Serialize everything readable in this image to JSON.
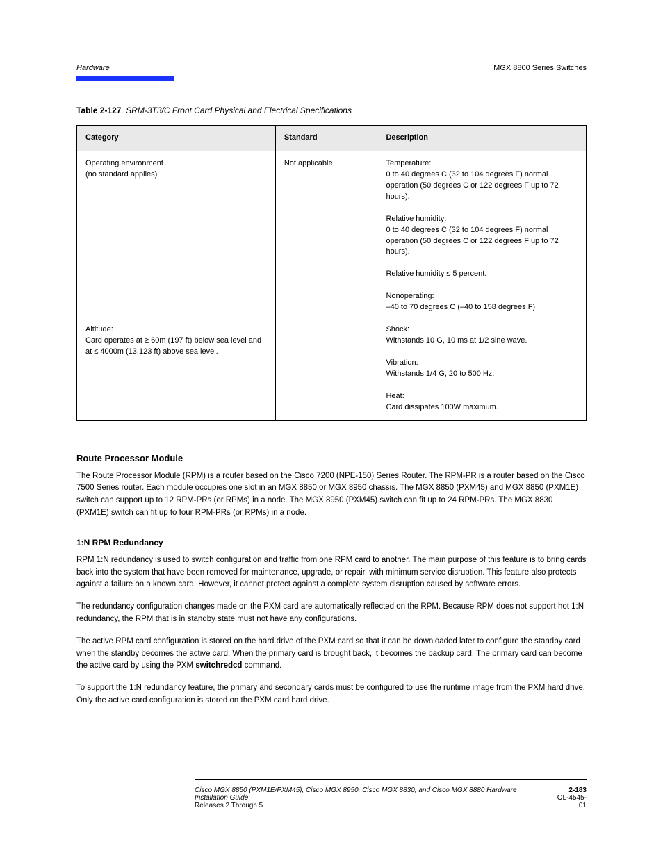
{
  "header": {
    "section": "Hardware",
    "subject": "MGX 8800 Series Switches"
  },
  "table": {
    "caption_prefix": "Table 2-127",
    "caption_text": "SRM-3T3/C Front Card Physical and Electrical Specifications",
    "headers": [
      "Category",
      "Standard",
      "Description"
    ],
    "row": {
      "category_lines": [
        "Operating environment",
        "(no standard applies)"
      ],
      "standard": "Not applicable",
      "description_lines": [
        "Temperature:",
        "0 to 40 degrees C (32 to 104 degrees F) normal operation (50 degrees C or 122 degrees F up to 72 hours).",
        "",
        "Relative humidity:",
        "0 to 40 degrees C (32 to 104 degrees F) normal operation (50 degrees C or 122 degrees F up to 72 hours).",
        "",
        "Relative humidity ≤ 5 percent.",
        "",
        "Nonoperating:",
        "–40 to 70 degrees C (–40 to 158 degrees F)",
        "",
        "Shock:",
        "Withstands 10 G, 10 ms at 1/2 sine wave.",
        "",
        "Vibration:",
        "Withstands 1/4 G, 20 to 500 Hz.",
        "",
        "Heat:",
        "Card dissipates 100W maximum."
      ],
      "category_extra_lines": [
        "",
        "Altitude:",
        "Card operates at ≥ 60m (197 ft) below sea level and at ≤ 4000m (13,123 ft) above sea level."
      ]
    }
  },
  "section": {
    "title": "Route Processor Module",
    "intro": "The Route Processor Module (RPM) is a router based on the Cisco 7200 (NPE-150) Series Router. The RPM-PR is a router based on the Cisco 7500 Series router. Each module occupies one slot in an MGX 8850 or MGX 8950 chassis. The MGX 8850 (PXM45) and MGX 8850 (PXM1E) switch can support up to 12 RPM-PRs (or RPMs) in a node. The MGX 8950 (PXM45) switch can fit up to 24 RPM-PRs. The MGX 8830 (PXM1E) switch can fit up to four RPM-PRs (or RPMs) in a node.",
    "subhead": "1:N RPM Redundancy",
    "paras": [
      "RPM 1:N redundancy is used to switch configuration and traffic from one RPM card to another. The main purpose of this feature is to bring cards back into the system that have been removed for maintenance, upgrade, or repair, with minimum service disruption. This feature also protects against a failure on a known card. However, it cannot protect against a complete system disruption caused by software errors.",
      "The redundancy configuration changes made on the PXM card are automatically reflected on the RPM. Because RPM does not support hot 1:N redundancy, the RPM that is in standby state must not have any configurations.",
      "The active RPM card configuration is stored on the hard drive of the PXM card so that it can be downloaded later to configure the standby card when the standby becomes the active card. When the primary card is brought back, it becomes the backup card. The primary card can become the active card by using the PXM switchredcd command.",
      "To support the 1:N redundancy feature, the primary and secondary cards must be configured to use the runtime image from the PXM hard drive. Only the active card configuration is stored on the PXM card hard drive."
    ]
  },
  "footer": {
    "left": "Cisco MGX 8850 (PXM1E/PXM45), Cisco MGX 8950, Cisco MGX 8830, and Cisco MGX 8880 Hardware Installation Guide",
    "right_doc": "OL-4545-01",
    "right_rel": "Releases 2 Through 5",
    "page": "2-183"
  }
}
